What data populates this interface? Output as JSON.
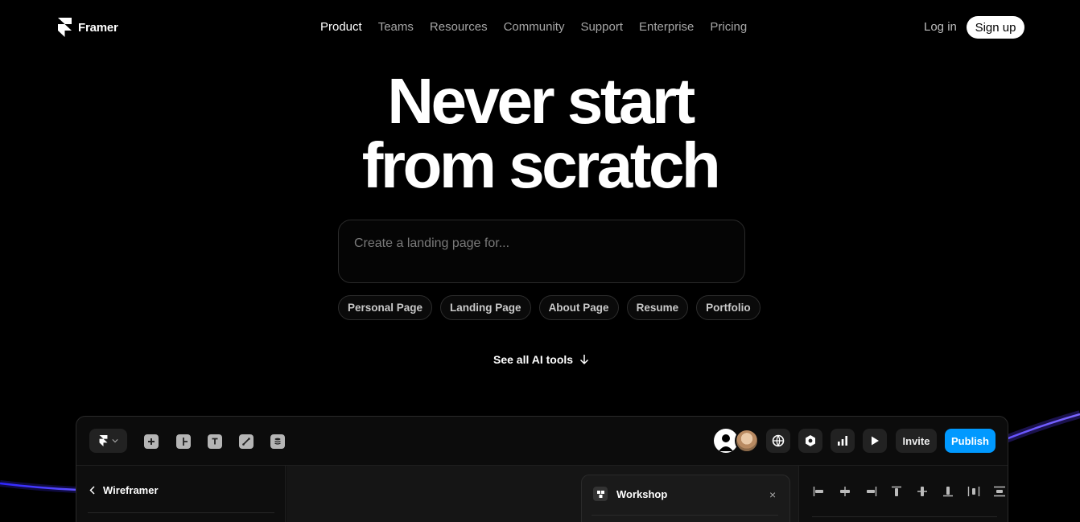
{
  "brand": {
    "name": "Framer"
  },
  "nav": {
    "items": [
      {
        "label": "Product",
        "active": true
      },
      {
        "label": "Teams",
        "active": false
      },
      {
        "label": "Resources",
        "active": false
      },
      {
        "label": "Community",
        "active": false
      },
      {
        "label": "Support",
        "active": false
      },
      {
        "label": "Enterprise",
        "active": false
      },
      {
        "label": "Pricing",
        "active": false
      }
    ],
    "login": "Log in",
    "signup": "Sign up"
  },
  "hero": {
    "title_line1": "Never start",
    "title_line2": "from scratch",
    "prompt_placeholder": "Create a landing page for...",
    "prompt_value": "",
    "chips": [
      "Personal Page",
      "Landing Page",
      "About Page",
      "Resume",
      "Portfolio"
    ],
    "ai_tools_link": "See all AI tools"
  },
  "editor": {
    "toolbar_icons": [
      "plus-icon",
      "layout-icon",
      "text-icon",
      "pen-icon",
      "database-icon"
    ],
    "right_icons": [
      "globe-icon",
      "settings-icon",
      "analytics-icon",
      "play-icon"
    ],
    "invite_label": "Invite",
    "publish_label": "Publish",
    "left_panel_title": "Wireframer",
    "workshop_title": "Workshop",
    "workshop_close": "×"
  },
  "colors": {
    "accent": "#0099ff",
    "background": "#000000",
    "glow": "#4b3cff"
  }
}
